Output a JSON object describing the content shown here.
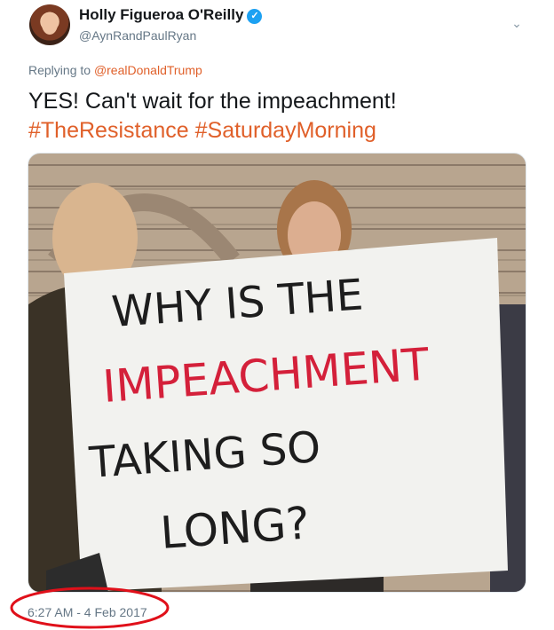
{
  "author": {
    "name": "Holly Figueroa O'Reilly",
    "handle": "@AynRandPaulRyan",
    "verified": true
  },
  "reply": {
    "prefix": "Replying to",
    "mention": "@realDonaldTrump"
  },
  "tweet": {
    "text": "YES! Can't wait for the impeachment!",
    "hashtag1": "#TheResistance",
    "hashtag2": "#SaturdayMorning"
  },
  "media": {
    "sign_line1": "WHY IS THE",
    "sign_line2": "IMPEACHMENT",
    "sign_line3": "TAKING SO",
    "sign_line4": "LONG?"
  },
  "timestamp": "6:27 AM - 4 Feb 2017",
  "colors": {
    "hashtag": "#e0602a",
    "verified": "#1da1f2",
    "annotation": "#e0101a"
  },
  "icons": {
    "verified": "verified-badge-icon",
    "menu": "chevron-down-icon"
  }
}
